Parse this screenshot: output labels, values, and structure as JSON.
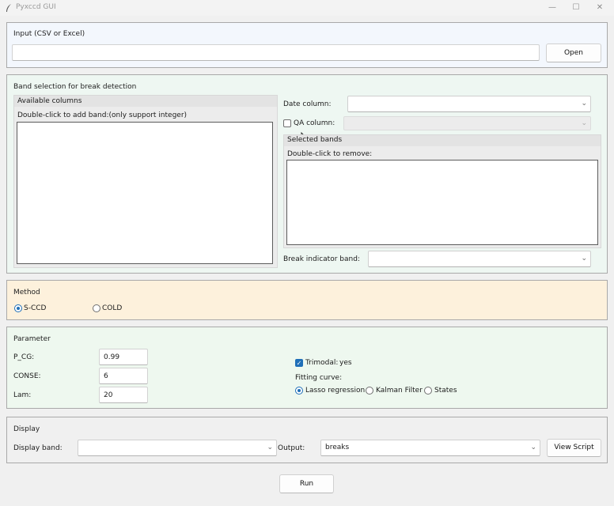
{
  "window": {
    "title": "Pyxccd GUI",
    "minimize": "—",
    "maximize": "☐",
    "close": "✕"
  },
  "input": {
    "section_title": "Input (CSV or Excel)",
    "path_value": "",
    "open_label": "Open"
  },
  "bands": {
    "section_title": "Band selection for break detection",
    "available_title": "Available columns",
    "available_hint": "Double-click to add band:(only support integer)",
    "date_label": "Date column:",
    "date_value": "",
    "qa_label": "QA column:",
    "qa_checked": false,
    "qa_value": "",
    "selected_title": "Selected bands",
    "selected_hint": "Double-click to remove:",
    "break_label": "Break indicator band:",
    "break_value": ""
  },
  "method": {
    "section_title": "Method",
    "options": [
      {
        "label": "S-CCD",
        "selected": true
      },
      {
        "label": "COLD",
        "selected": false
      }
    ]
  },
  "parameter": {
    "section_title": "Parameter",
    "pcg_label": "P_CG:",
    "pcg_value": "0.99",
    "conse_label": "CONSE:",
    "conse_value": "6",
    "lam_label": "Lam:",
    "lam_value": "20",
    "trimodal_label": "Trimodal:",
    "trimodal_checked": true,
    "trimodal_state": "yes",
    "fitting_label": "Fitting curve:",
    "fitting_options": [
      {
        "label": "Lasso regression",
        "selected": true
      },
      {
        "label": "Kalman Filter",
        "selected": false
      },
      {
        "label": "States",
        "selected": false
      }
    ]
  },
  "display": {
    "section_title": "Display",
    "band_label": "Display band:",
    "band_value": "",
    "output_label": "Output:",
    "output_value": "breaks",
    "view_script_label": "View Script"
  },
  "run_label": "Run",
  "colors": {
    "input_bg": "#f3f7fd",
    "bands_bg": "#eef7f2",
    "method_bg": "#fdf1dc",
    "parameter_bg": "#eef8ef",
    "display_bg": "#f0f0f0",
    "accent": "#1f6fb8"
  }
}
